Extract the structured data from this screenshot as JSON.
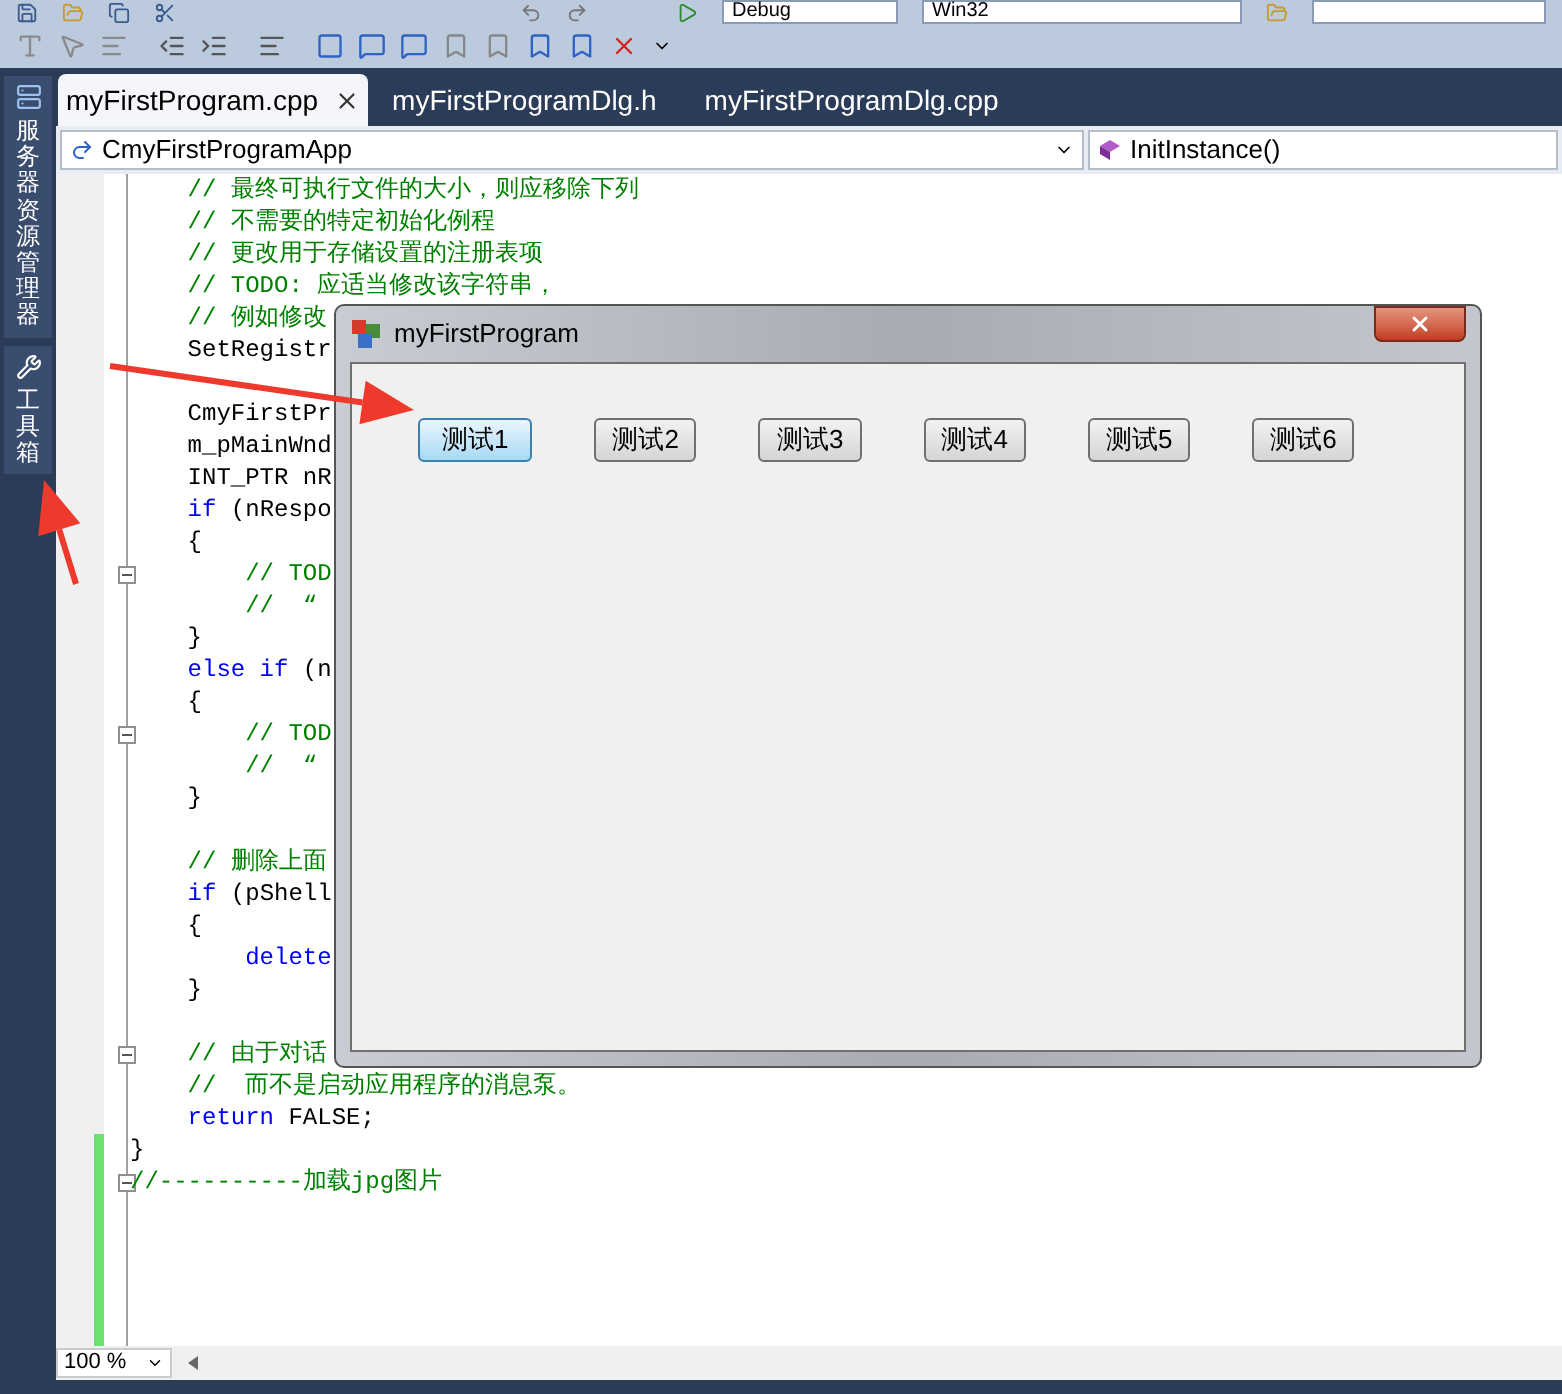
{
  "toolbar": {
    "configuration": "Debug",
    "platform": "Win32"
  },
  "side_panel": [
    {
      "label": "服务器资源管理器"
    },
    {
      "label": "工具箱"
    }
  ],
  "tabs": [
    {
      "label": "myFirstProgram.cpp",
      "selected": true
    },
    {
      "label": "myFirstProgramDlg.h",
      "selected": false
    },
    {
      "label": "myFirstProgramDlg.cpp",
      "selected": false
    }
  ],
  "navigation": {
    "class": "CmyFirstProgramApp",
    "member": "InitInstance()"
  },
  "code_lines": [
    {
      "kind": "code",
      "segments": [
        {
          "text": "    // 最终可执行文件的大小，则应移除下列",
          "kind": "comment"
        }
      ]
    },
    {
      "kind": "code",
      "segments": [
        {
          "text": "    // 不需要的特定初始化例程",
          "kind": "comment"
        }
      ]
    },
    {
      "kind": "code",
      "segments": [
        {
          "text": "    // 更改用于存储设置的注册表项",
          "kind": "comment"
        }
      ]
    },
    {
      "kind": "code",
      "segments": [
        {
          "text": "    // TODO: 应适当修改该字符串，",
          "kind": "comment"
        }
      ]
    },
    {
      "kind": "code",
      "segments": [
        {
          "text": "    // 例如修改",
          "kind": "comment"
        }
      ]
    },
    {
      "kind": "code",
      "segments": [
        {
          "text": "    SetRegistr",
          "kind": "plain"
        }
      ]
    },
    {
      "kind": "blank"
    },
    {
      "kind": "code",
      "segments": [
        {
          "text": "    CmyFirstPr",
          "kind": "plain"
        }
      ]
    },
    {
      "kind": "code",
      "segments": [
        {
          "text": "    m_pMainWnd",
          "kind": "plain"
        }
      ]
    },
    {
      "kind": "code",
      "segments": [
        {
          "text": "    INT_PTR nR",
          "kind": "plain"
        }
      ]
    },
    {
      "kind": "code",
      "segments": [
        {
          "text": "    if",
          "kind": "keyword"
        },
        {
          "text": " (nRespo",
          "kind": "plain"
        }
      ]
    },
    {
      "kind": "code",
      "segments": [
        {
          "text": "    {",
          "kind": "plain"
        }
      ]
    },
    {
      "kind": "code",
      "fold": true,
      "segments": [
        {
          "text": "        // TOD",
          "kind": "comment"
        }
      ]
    },
    {
      "kind": "code",
      "segments": [
        {
          "text": "        //  “",
          "kind": "comment"
        }
      ]
    },
    {
      "kind": "code",
      "segments": [
        {
          "text": "    }",
          "kind": "plain"
        }
      ]
    },
    {
      "kind": "code",
      "segments": [
        {
          "text": "    else if",
          "kind": "keyword"
        },
        {
          "text": " (n",
          "kind": "plain"
        }
      ]
    },
    {
      "kind": "code",
      "segments": [
        {
          "text": "    {",
          "kind": "plain"
        }
      ]
    },
    {
      "kind": "code",
      "fold": true,
      "segments": [
        {
          "text": "        // TOD",
          "kind": "comment"
        }
      ]
    },
    {
      "kind": "code",
      "segments": [
        {
          "text": "        //  “",
          "kind": "comment"
        }
      ]
    },
    {
      "kind": "code",
      "segments": [
        {
          "text": "    }",
          "kind": "plain"
        }
      ]
    },
    {
      "kind": "blank"
    },
    {
      "kind": "code",
      "segments": [
        {
          "text": "    // 删除上面",
          "kind": "comment"
        }
      ]
    },
    {
      "kind": "code",
      "segments": [
        {
          "text": "    if",
          "kind": "keyword"
        },
        {
          "text": " (pShell",
          "kind": "plain"
        }
      ]
    },
    {
      "kind": "code",
      "segments": [
        {
          "text": "    {",
          "kind": "plain"
        }
      ]
    },
    {
      "kind": "code",
      "segments": [
        {
          "text": "        delete",
          "kind": "keyword"
        }
      ]
    },
    {
      "kind": "code",
      "segments": [
        {
          "text": "    }",
          "kind": "plain"
        }
      ]
    },
    {
      "kind": "blank"
    },
    {
      "kind": "code",
      "fold": true,
      "segments": [
        {
          "text": "    // 由于对话",
          "kind": "comment"
        }
      ]
    },
    {
      "kind": "code",
      "segments": [
        {
          "text": "    //  而不是启动应用程序的消息泵。",
          "kind": "comment"
        }
      ]
    },
    {
      "kind": "code",
      "segments": [
        {
          "text": "    return",
          "kind": "keyword"
        },
        {
          "text": " FALSE;",
          "kind": "plain"
        }
      ]
    },
    {
      "kind": "code",
      "changed": true,
      "segments": [
        {
          "text": "}",
          "kind": "plain"
        }
      ]
    },
    {
      "kind": "code",
      "changed": true,
      "fold": true,
      "segments": [
        {
          "text": "//----------加载jpg图片",
          "kind": "comment"
        }
      ]
    },
    {
      "kind": "blank",
      "changed": true
    },
    {
      "kind": "blank",
      "changed": true
    },
    {
      "kind": "blank",
      "changed": true
    },
    {
      "kind": "blank",
      "changed": true
    },
    {
      "kind": "blank",
      "changed": true
    }
  ],
  "zoom": "100 %",
  "dialog": {
    "title": "myFirstProgram",
    "buttons": [
      {
        "label": "测试1",
        "focused": true
      },
      {
        "label": "测试2",
        "focused": false
      },
      {
        "label": "测试3",
        "focused": false
      },
      {
        "label": "测试4",
        "focused": false
      },
      {
        "label": "测试5",
        "focused": false
      },
      {
        "label": "测试6",
        "focused": false
      }
    ]
  }
}
